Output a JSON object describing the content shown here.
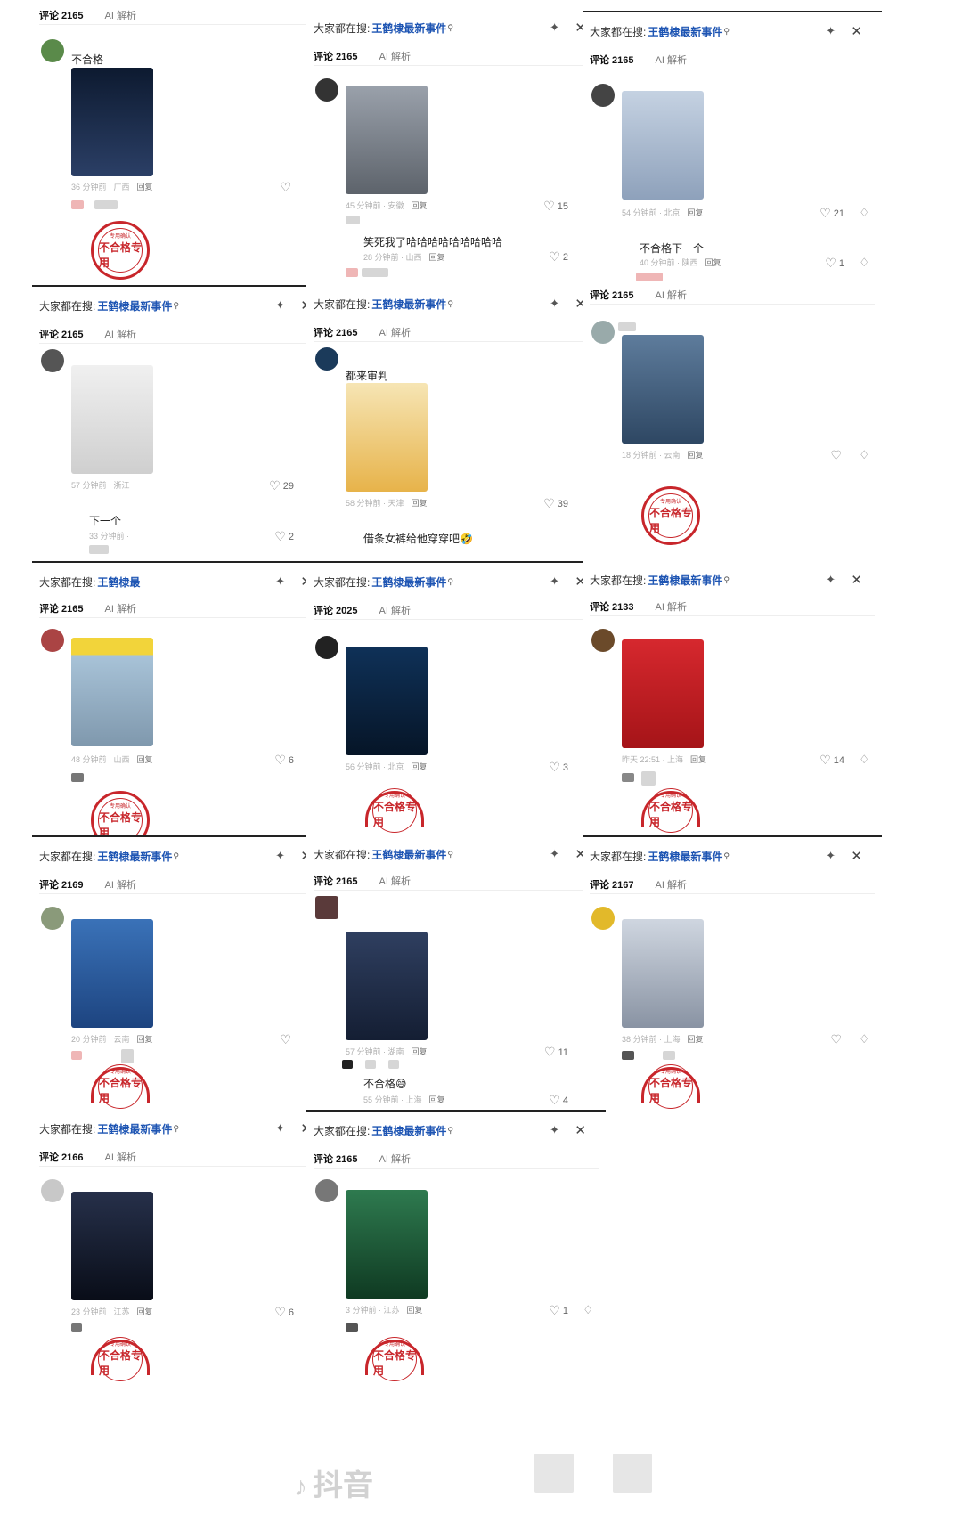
{
  "search": {
    "prefix": "大家都在搜:",
    "term": "王鹤棣最新事件",
    "term_short": "王鹤棣最",
    "icon": "search-icon"
  },
  "tabs": {
    "comments": "评论 2165",
    "ai": "AI 解析"
  },
  "stamp": {
    "top": "专用确认",
    "text": "不合格专用"
  },
  "reply_label": "回复",
  "watermark": "抖音",
  "panels": [
    {
      "id": "p1",
      "tab_comments": "评论 2165",
      "comment": "不合格",
      "time": "36 分钟前 · 广西",
      "likes": "",
      "photo_color": "#1b2a44"
    },
    {
      "id": "p2",
      "tab_comments": "评论 2165",
      "time": "45 分钟前 · 安徽",
      "likes": "15",
      "reply_comment": "笑死我了哈哈哈哈哈哈哈哈哈",
      "reply_time": "28 分钟前 · 山西",
      "reply_likes": "2",
      "photo_color": "#7b7f86"
    },
    {
      "id": "p3",
      "tab_comments": "评论 2165",
      "time": "54 分钟前 · 北京",
      "likes": "21",
      "reply_comment": "不合格下一个",
      "reply_time": "40 分钟前 · 陕西",
      "reply_likes": "1",
      "photo_color": "#b9c6d8"
    },
    {
      "id": "p4",
      "tab_comments": "评论 2165",
      "time": "57 分钟前 · 浙江",
      "likes": "29",
      "reply_comment": "下一个",
      "reply_time": "33 分钟前 ·",
      "reply_likes": "2",
      "photo_color": "#e6e6e6"
    },
    {
      "id": "p5",
      "tab_comments": "评论 2165",
      "comment": "都来审判",
      "time": "58 分钟前 · 天津",
      "likes": "39",
      "reply_comment": "借条女裤给他穿穿吧🤣",
      "photo_color": "#f0d9a0"
    },
    {
      "id": "p6",
      "tab_comments": "评论 2165",
      "time": "18 分钟前 · 云南",
      "likes": "",
      "photo_color": "#4b6a8c"
    },
    {
      "id": "p7",
      "tab_comments": "评论 2165",
      "time": "48 分钟前 · 山西",
      "likes": "6",
      "photo_color": "#8fb0c9"
    },
    {
      "id": "p8",
      "tab_comments": "评论 2025",
      "time": "56 分钟前 · 北京",
      "likes": "3",
      "photo_color": "#102a4a"
    },
    {
      "id": "p9",
      "tab_comments": "评论 2133",
      "time": "昨天 22:51 · 上海",
      "likes": "14",
      "photo_color": "#c81e24"
    },
    {
      "id": "p10",
      "tab_comments": "评论 2169",
      "time": "20 分钟前 · 云南",
      "likes": "",
      "photo_color": "#2f5fa0"
    },
    {
      "id": "p11",
      "tab_comments": "评论 2165",
      "time": "57 分钟前 · 湖南",
      "likes": "11",
      "reply_comment": "不合格😅",
      "reply_time": "55 分钟前 · 上海",
      "reply_likes": "4",
      "photo_color": "#24324f"
    },
    {
      "id": "p12",
      "tab_comments": "评论 2167",
      "time": "38 分钟前 · 上海",
      "likes": "",
      "photo_color": "#aeb6c4"
    },
    {
      "id": "p13",
      "tab_comments": "评论 2166",
      "time": "23 分钟前 · 江苏",
      "likes": "6",
      "photo_color": "#141a2a"
    },
    {
      "id": "p14",
      "tab_comments": "评论 2165",
      "time": "3 分钟前 · 江苏",
      "likes": "1",
      "photo_color": "#1f5a3a"
    }
  ]
}
